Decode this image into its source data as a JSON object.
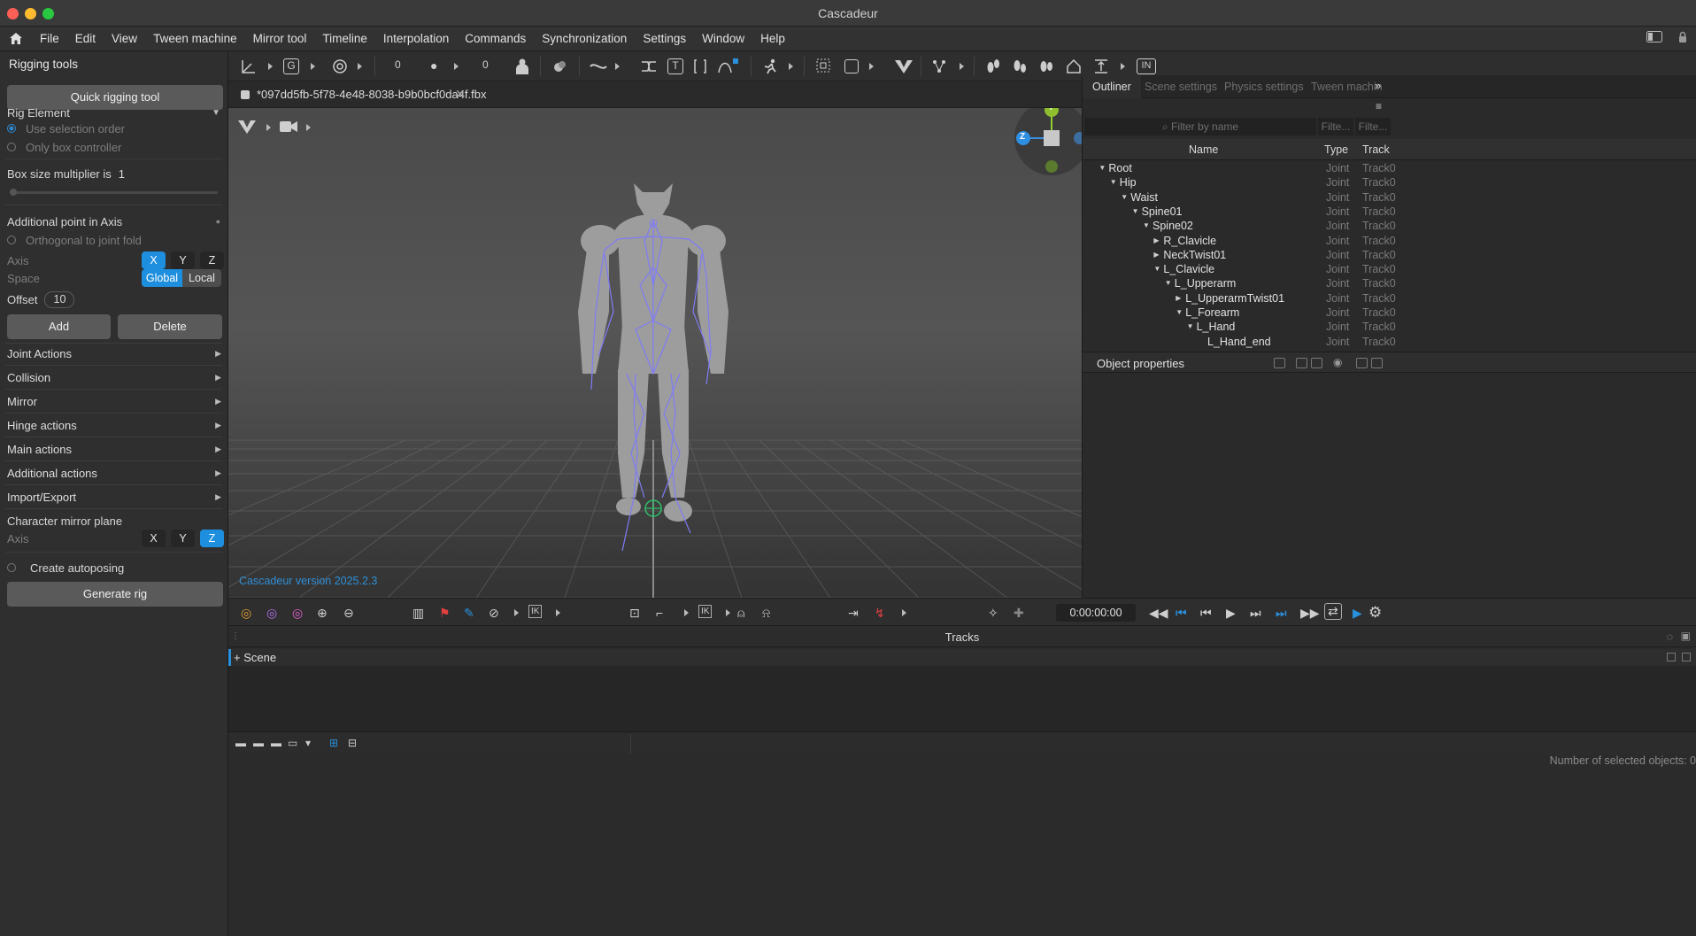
{
  "window": {
    "title": "Cascadeur"
  },
  "menu": [
    "File",
    "Edit",
    "View",
    "Tween machine",
    "Mirror tool",
    "Timeline",
    "Interpolation",
    "Commands",
    "Synchronization",
    "Settings",
    "Window",
    "Help"
  ],
  "left_panel": {
    "title": "Rigging tools",
    "quick_rig_button": "Quick rigging tool",
    "rig_element_label": "Rig Element",
    "use_selection_order": "Use selection order",
    "only_box_controller": "Only box controller",
    "box_size_label": "Box size multiplier is",
    "box_size_value": "1",
    "additional_point_label": "Additional point in Axis",
    "orthogonal_label": "Orthogonal to joint fold",
    "axis_label": "Axis",
    "axis_options": [
      "X",
      "Y",
      "Z"
    ],
    "axis_selected": "X",
    "space_label": "Space",
    "space_options": [
      "Global",
      "Local"
    ],
    "space_selected": "Global",
    "offset_label": "Offset",
    "offset_value": "10",
    "add_button": "Add",
    "delete_button": "Delete",
    "sections": [
      "Joint Actions",
      "Collision",
      "Mirror",
      "Hinge actions",
      "Main actions",
      "Additional actions",
      "Import/Export"
    ],
    "mirror_plane_label": "Character mirror plane",
    "mirror_axis_label": "Axis",
    "mirror_axis_options": [
      "X",
      "Y",
      "Z"
    ],
    "mirror_axis_selected": "Z",
    "create_autoposing": "Create autoposing",
    "generate_rig_button": "Generate rig"
  },
  "toolbar": {
    "values": [
      "0",
      "0"
    ],
    "labels": [
      "G",
      "T",
      "IN"
    ]
  },
  "document_tab": {
    "label": "*097dd5fb-5f78-4e48-8038-b9b0bcf0da4f.fbx"
  },
  "viewport": {
    "version_text": "Cascadeur version 2025.2.3",
    "gizmo_labels": [
      "Y",
      "Z"
    ]
  },
  "right_panel": {
    "tabs": [
      "Outliner",
      "Scene settings",
      "Physics settings",
      "Tween machin"
    ],
    "active_tab": "Outliner",
    "filter_placeholder": "Filter by name",
    "filter_type": "Filte...",
    "filter_track": "Filte...",
    "columns": [
      "Name",
      "Type",
      "Track"
    ],
    "rows": [
      {
        "name": "Root",
        "type": "Joint",
        "track": "Track0"
      },
      {
        "name": "Hip",
        "type": "Joint",
        "track": "Track0"
      },
      {
        "name": "Waist",
        "type": "Joint",
        "track": "Track0"
      },
      {
        "name": "Spine01",
        "type": "Joint",
        "track": "Track0"
      },
      {
        "name": "Spine02",
        "type": "Joint",
        "track": "Track0"
      },
      {
        "name": "R_Clavicle",
        "type": "Joint",
        "track": "Track0"
      },
      {
        "name": "NeckTwist01",
        "type": "Joint",
        "track": "Track0"
      },
      {
        "name": "L_Clavicle",
        "type": "Joint",
        "track": "Track0"
      },
      {
        "name": "L_Upperarm",
        "type": "Joint",
        "track": "Track0"
      },
      {
        "name": "L_UpperarmTwist01",
        "type": "Joint",
        "track": "Track0"
      },
      {
        "name": "L_Forearm",
        "type": "Joint",
        "track": "Track0"
      },
      {
        "name": "L_Hand",
        "type": "Joint",
        "track": "Track0"
      },
      {
        "name": "L_Hand_end",
        "type": "Joint",
        "track": "Track0"
      }
    ],
    "object_properties": "Object properties"
  },
  "timeline": {
    "time": "0:00:00:00",
    "labels": [
      "IK",
      "IK"
    ]
  },
  "tracks": {
    "title": "Tracks",
    "scene_label": "+ Scene"
  },
  "status": {
    "selected_objects": "Number of selected objects: 0"
  }
}
